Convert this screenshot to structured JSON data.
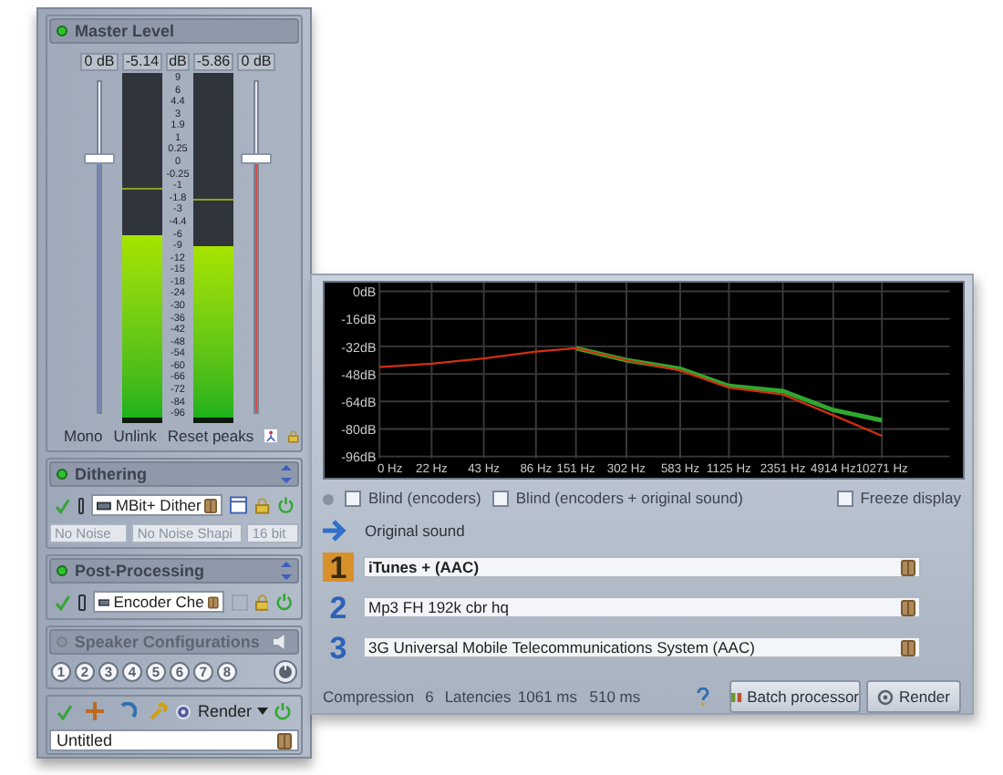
{
  "master_level": {
    "title": "Master Level",
    "active": true,
    "readouts": [
      "0 dB",
      "-5.14",
      "dB",
      "-5.86",
      "0 dB"
    ],
    "scale": [
      "9",
      "6",
      "4.4",
      "3",
      "1.9",
      "1",
      "0.25",
      "0",
      "-0.25",
      "-1",
      "-1.8",
      "-3",
      "-4.4",
      "-6",
      "-9",
      "-12",
      "-15",
      "-18",
      "-24",
      "-30",
      "-36",
      "-42",
      "-48",
      "-54",
      "-60",
      "-66",
      "-72",
      "-84",
      "-96"
    ],
    "sliders": [
      {
        "level": 0.77,
        "color": "#6f86d8"
      },
      {
        "level": 0.77,
        "color": "#d05050"
      }
    ],
    "meters": [
      {
        "level": 0.53,
        "peak": {
          "level": 0.66
        }
      },
      {
        "level": 0.5,
        "peak": {
          "level": 0.63
        }
      }
    ],
    "buttons": [
      "Mono",
      "Unlink",
      "Reset peaks"
    ]
  },
  "dithering": {
    "title": "Dithering",
    "active": true,
    "plugin": "MBit+ Dither",
    "fields": [
      {
        "value": "No Noise",
        "disabled": true
      },
      {
        "value": "No Noise Shapi",
        "disabled": true
      },
      {
        "value": "16 bit",
        "disabled": true
      }
    ]
  },
  "post_processing": {
    "title": "Post-Processing",
    "active": true,
    "plugin": "Encoder Che"
  },
  "speaker_configurations": {
    "title": "Speaker Configurations",
    "active": false,
    "presets": [
      "1",
      "2",
      "3",
      "4",
      "5",
      "6",
      "7",
      "8"
    ]
  },
  "toolbar": {
    "render_label": "Render"
  },
  "project_name": "Untitled",
  "spectrum": {
    "chart_data": {
      "type": "line",
      "x": [
        "0 Hz",
        "22 Hz",
        "43 Hz",
        "86 Hz",
        "151 Hz",
        "302 Hz",
        "583 Hz",
        "1125 Hz",
        "2351 Hz",
        "4914 Hz",
        "10271 Hz"
      ],
      "yticks": [
        {
          "value": 0,
          "label": "0dB"
        },
        {
          "value": -16,
          "label": "-16dB"
        },
        {
          "value": -32,
          "label": "-32dB"
        },
        {
          "value": -48,
          "label": "-48dB"
        },
        {
          "value": -64,
          "label": "-64dB"
        },
        {
          "value": -80,
          "label": "-80dB"
        },
        {
          "value": -96,
          "label": "-96dB"
        }
      ],
      "ylim": [
        -96,
        0
      ],
      "grid": true,
      "series": [
        {
          "color": "#2fa82f",
          "values": [
            null,
            null,
            null,
            null,
            -33,
            -40,
            -45,
            -55,
            -58,
            -69,
            -75
          ]
        },
        {
          "color": "#d03010",
          "values": [
            -44,
            -42,
            -39,
            -35,
            -33,
            -40,
            -46,
            -56,
            -60,
            -72,
            -84
          ]
        }
      ]
    }
  },
  "options": [
    {
      "label": "Blind (encoders)",
      "checked": false
    },
    {
      "label": "Blind (encoders + original sound)",
      "checked": false
    },
    {
      "label": "Freeze display",
      "checked": false
    }
  ],
  "original_sound": "Original sound",
  "encoders": [
    {
      "number": "1",
      "name": "iTunes + (AAC)",
      "selected": true
    },
    {
      "number": "2",
      "name": "Mp3 FH 192k cbr hq",
      "selected": false
    },
    {
      "number": "3",
      "name": "3G Universal Mobile Telecommunications System (AAC)",
      "selected": false
    }
  ],
  "footer": {
    "compression_label": "Compression",
    "compression": "6",
    "latencies_label": "Latencies",
    "latencies": [
      "1061 ms",
      "510 ms"
    ],
    "buttons": [
      "Batch processor",
      "Render"
    ]
  }
}
